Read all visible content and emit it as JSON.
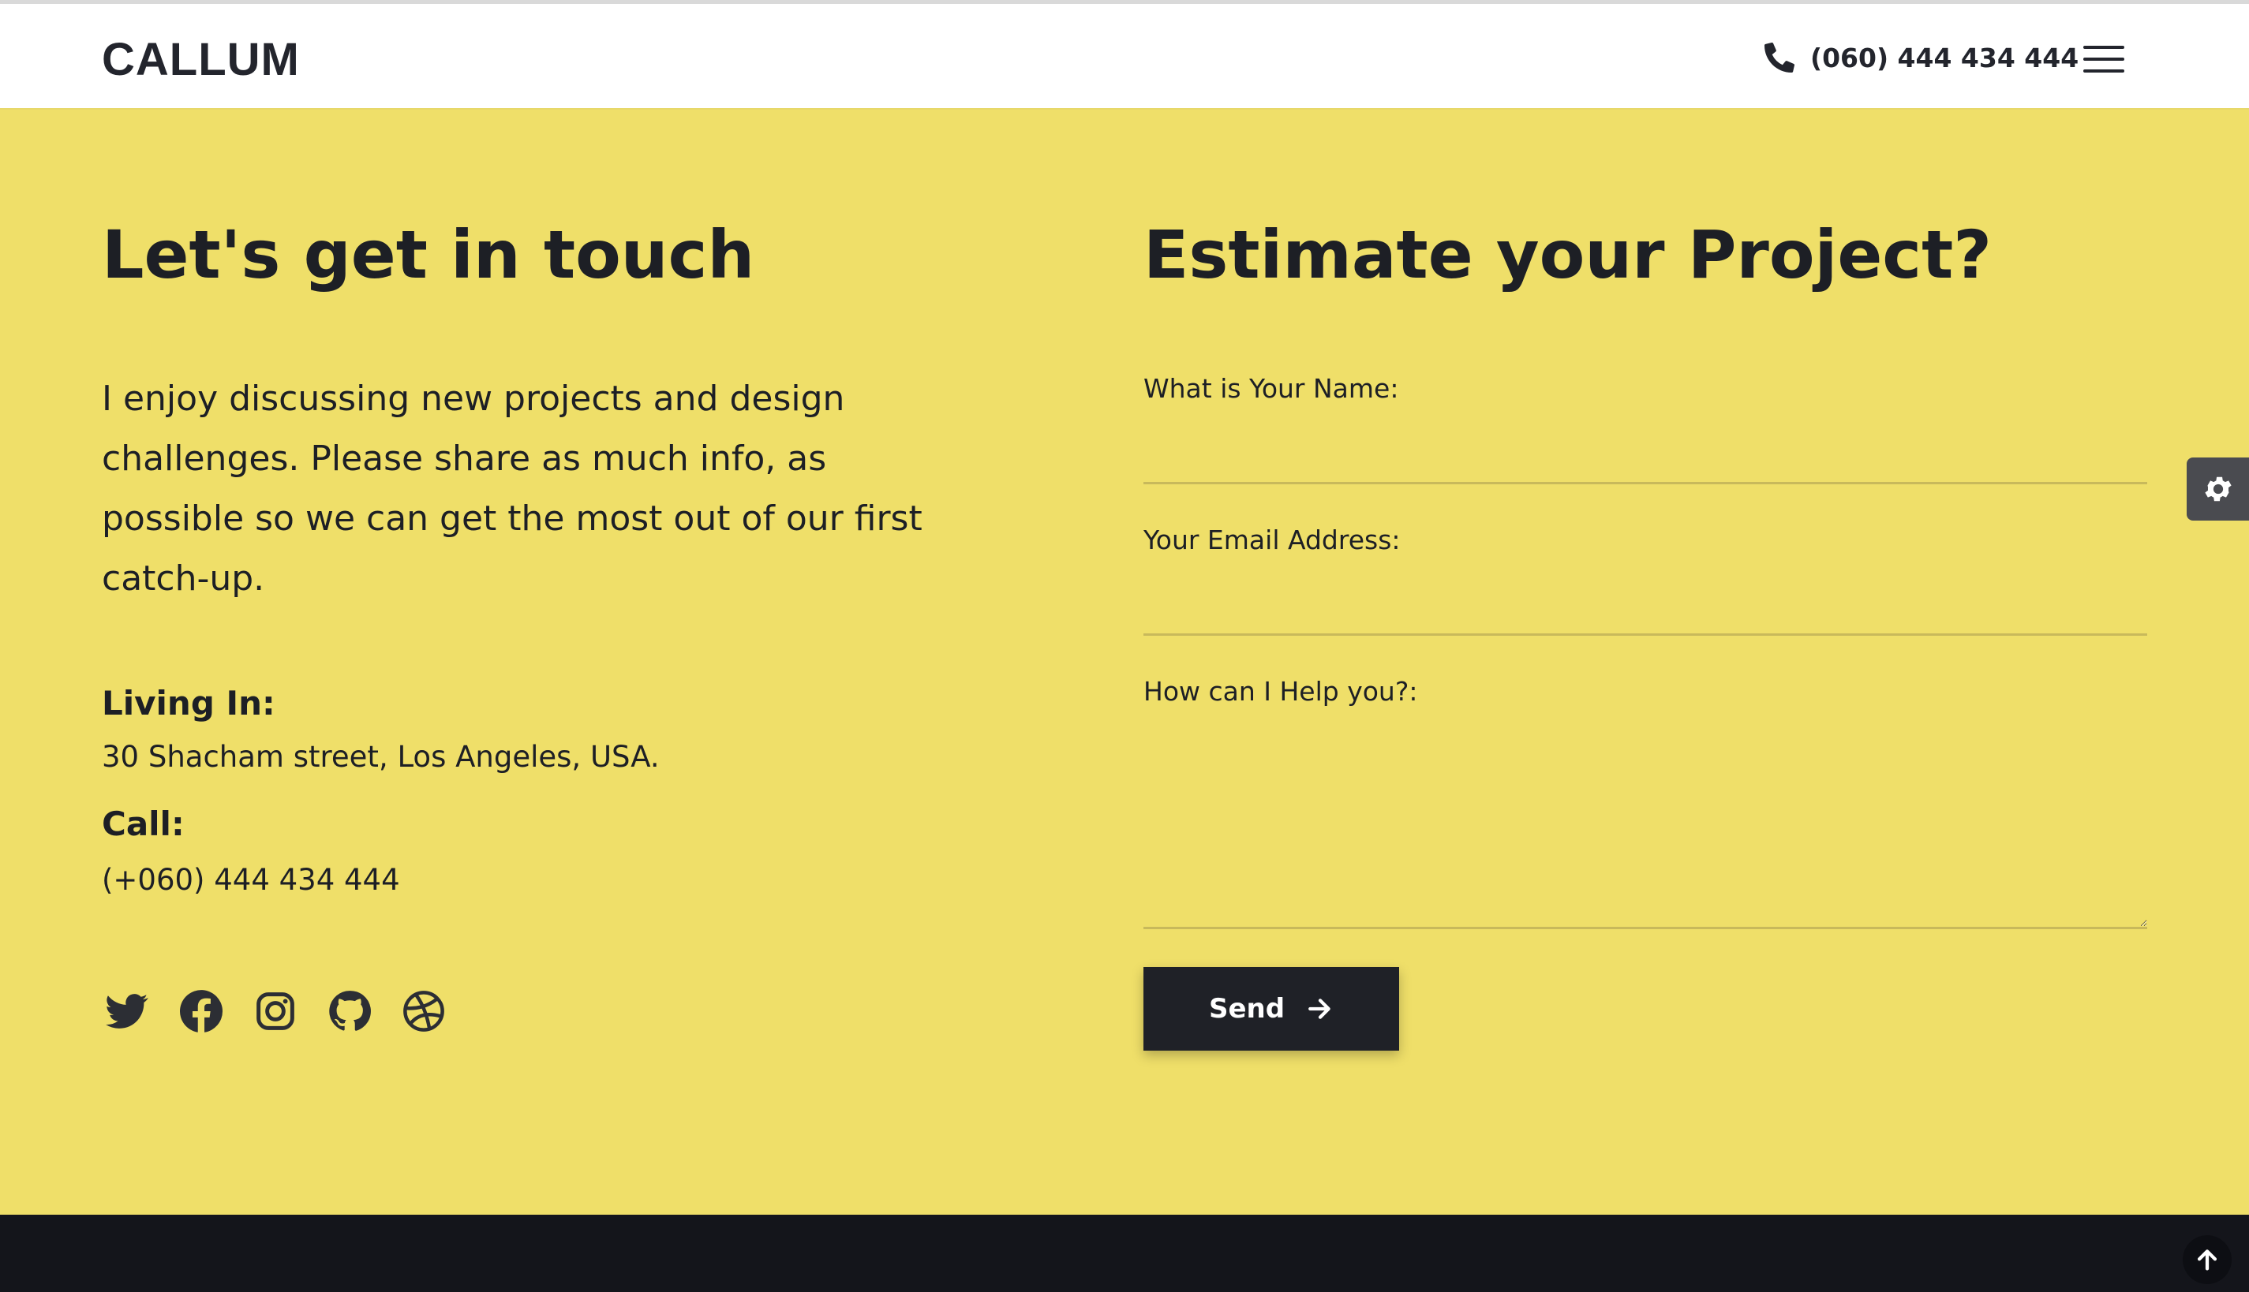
{
  "header": {
    "logo": "CALLUM",
    "phone": "(060) 444 434 444"
  },
  "contact": {
    "title": "Let's get in touch",
    "intro": "I enjoy discussing new projects and design challenges. Please share as much info, as possible so we can get the most out of our first catch-up.",
    "living_label": "Living In:",
    "living_value": "30 Shacham street, Los Angeles, USA.",
    "call_label": "Call:",
    "call_value": "(+060) 444 434 444",
    "socials": [
      "twitter-icon",
      "facebook-icon",
      "instagram-icon",
      "github-icon",
      "dribbble-icon"
    ]
  },
  "form": {
    "title": "Estimate your Project?",
    "name_label": "What is Your Name:",
    "name_value": "",
    "email_label": "Your Email Address:",
    "email_value": "",
    "help_label": "How can I Help you?:",
    "help_value": "",
    "send_label": "Send"
  },
  "colors": {
    "accent": "#efdf69",
    "dark": "#1f2127",
    "footer": "#14151b"
  }
}
